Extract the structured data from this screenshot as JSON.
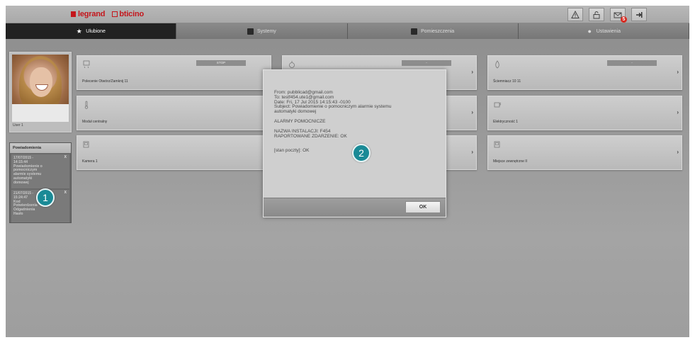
{
  "header": {
    "brand_legrand": "legrand",
    "brand_bticino": "bticino",
    "icons": [
      "alert-icon",
      "lock-icon",
      "mail-icon",
      "exit-icon"
    ],
    "mail_badge": "5"
  },
  "tabs": [
    {
      "label": "Ulubione",
      "icon": "star-icon",
      "active": true
    },
    {
      "label": "Systemy",
      "icon": "systems-icon",
      "active": false
    },
    {
      "label": "Pomieszczenia",
      "icon": "rooms-icon",
      "active": false
    },
    {
      "label": "Ustawienia",
      "icon": "settings-icon",
      "active": false
    }
  ],
  "user": {
    "name": "User 1"
  },
  "notifications": {
    "title": "Powiadomienia",
    "items": [
      {
        "text": "17/07/2015 -\n14:15:44\nPowiadomienie o\npomocniczym\nalarmie systemu\nautomatyki\ndomowej",
        "close": "X"
      },
      {
        "text": "21/07/2015 -\n15:24:47\nKod\nPotwierdzenia\nOdgadnienia\nHasło",
        "close": "X"
      }
    ]
  },
  "tiles": [
    {
      "name": "Polecenie Otwórz/Zamknij 11",
      "icon": "shutter-icon",
      "status": "STOP"
    },
    {
      "name": "",
      "icon": "light-icon",
      "status": "-"
    },
    {
      "name": "Ściemniacz 10 11",
      "icon": "dimmer-icon",
      "status": "-"
    },
    {
      "name": "Moduł centralny",
      "icon": "thermometer-icon",
      "status": ""
    },
    {
      "name": "",
      "icon": "",
      "status": ""
    },
    {
      "name": "Elektryczność 1",
      "icon": "plug-icon",
      "status": ""
    },
    {
      "name": "Kamera 1",
      "icon": "camera-icon",
      "status": ""
    },
    {
      "name": "",
      "icon": "",
      "status": ""
    },
    {
      "name": "Miejsce zewnętrzne II",
      "icon": "camera-icon",
      "status": ""
    }
  ],
  "dialog": {
    "from": "From: pubblicad@gmail.com",
    "to": "To: testf454.ute1@gmail.com",
    "date": "Date: Fri, 17 Jul 2015 14:15:43 -0100",
    "subject1": "Subject: Powiadomienie o pomocniczym alarmie systemu",
    "subject2": "automatyki domowej",
    "alarm_title": "ALARMY POMOCNICZE",
    "install_name": "NAZWA INSTALACJI: F454",
    "reported": "RAPORTOWANE ZDARZENIE: OK",
    "mail_status": "[stan poczty]: OK",
    "ok_label": "OK"
  },
  "callouts": [
    "1",
    "2"
  ]
}
